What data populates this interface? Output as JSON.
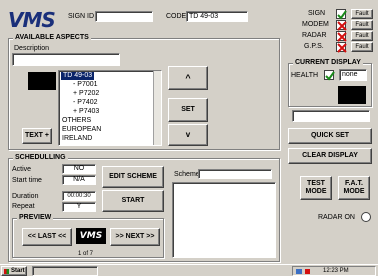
{
  "header": {
    "logo": "VMS",
    "sign_id_label": "SIGN ID",
    "sign_id_value": "",
    "code_label": "CODE",
    "code_value": "TD 49-03"
  },
  "status": {
    "items": [
      {
        "label": "SIGN",
        "fault": "Fault",
        "state": "ok"
      },
      {
        "label": "MODEM",
        "fault": "Fault",
        "state": "fault"
      },
      {
        "label": "RADAR",
        "fault": "Fault",
        "state": "fault"
      },
      {
        "label": "G.P.S.",
        "fault": "Fault",
        "state": "fault"
      }
    ]
  },
  "aspects": {
    "title": "AVAILABLE ASPECTS",
    "description_label": "Description",
    "description_value": "",
    "tree": [
      "TD 49-03",
      "P7001",
      "P7202",
      "P7402",
      "P7403",
      "OTHERS",
      "EUROPEAN",
      "IRELAND"
    ],
    "up_label": "^",
    "set_label": "SET",
    "down_label": "v",
    "text_plus_label": "TEXT +"
  },
  "current": {
    "title": "CURRENT DISPLAY",
    "health_label": "HEALTH",
    "health_value": "none"
  },
  "actions": {
    "quick_set": "QUICK SET",
    "clear_display": "CLEAR DISPLAY",
    "test_mode": "TEST MODE",
    "fat_mode": "F.A.T. MODE",
    "radar_on": "RADAR ON"
  },
  "scheduling": {
    "title": "SCHEDULLING",
    "rows": [
      {
        "label": "Active",
        "value": "NO"
      },
      {
        "label": "Start time",
        "value": "N/A"
      },
      {
        "label": "Duration",
        "value": "00:00:30"
      },
      {
        "label": "Repeat",
        "value": "Y"
      }
    ],
    "edit_scheme": "EDIT SCHEME",
    "start": "START",
    "scheme_label": "Scheme"
  },
  "preview": {
    "title": "PREVIEW",
    "last": "<< LAST <<",
    "next": ">> NEXT >>",
    "logo": "VMS",
    "counter": "1 of 7"
  },
  "taskbar": {
    "start": "Start",
    "clock": "12:23 PM"
  },
  "colors": {
    "logo_blue": "#1a2f7a",
    "ok_green": "#1a8a1a",
    "fault_red": "#d41010",
    "selection": "#0a246a"
  }
}
